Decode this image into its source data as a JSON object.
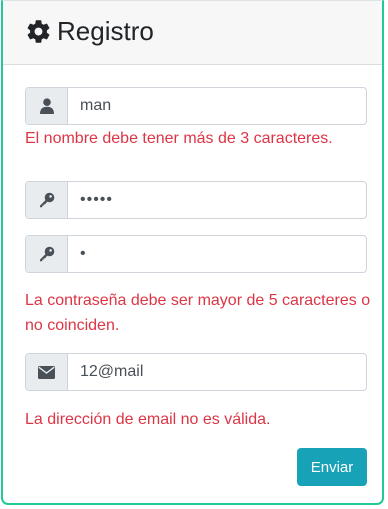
{
  "header": {
    "icon": "gear-icon",
    "title": "Registro"
  },
  "form": {
    "username": {
      "icon": "user-icon",
      "value": "man",
      "error": "El nombre debe tener más de 3 caracteres."
    },
    "password": {
      "icon": "key-icon",
      "value": "•••••"
    },
    "password_confirm": {
      "icon": "key-icon",
      "value": "•"
    },
    "password_error": "La contraseña debe ser mayor de 5 caracteres o no coinciden.",
    "email": {
      "icon": "envelope-icon",
      "value": "12@mail",
      "error": "La dirección de email no es válida."
    },
    "submit_label": "Enviar"
  },
  "colors": {
    "error": "#dc3545",
    "accent_button": "#17a2b8",
    "card_border": "#20c997"
  }
}
